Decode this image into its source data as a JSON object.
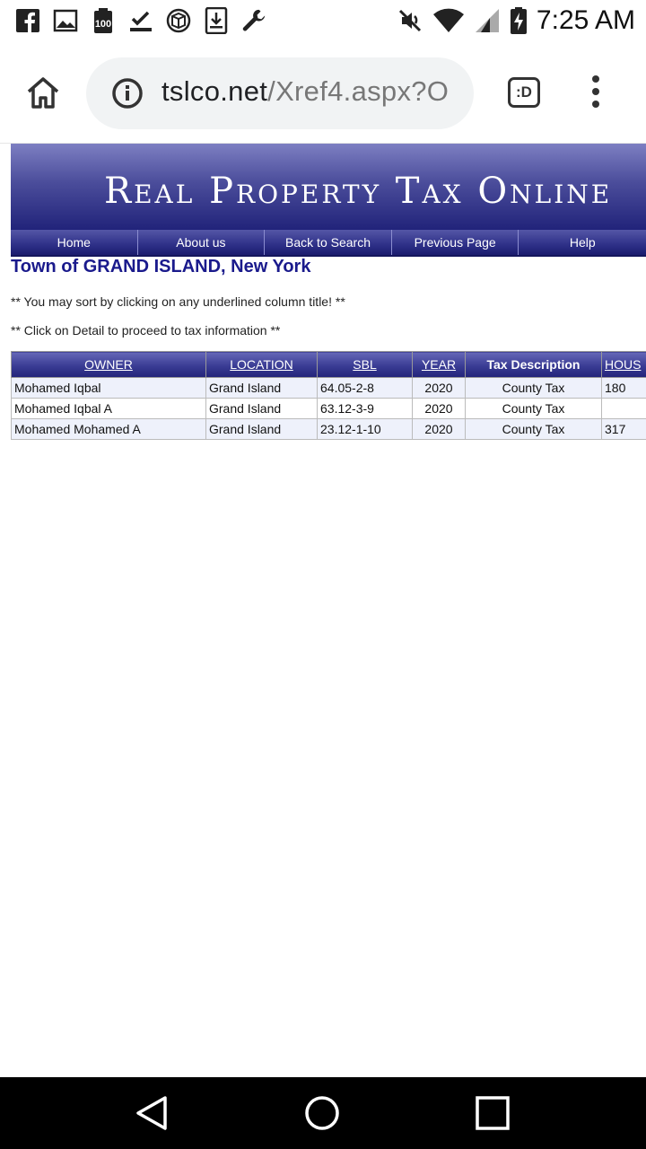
{
  "status_bar": {
    "time": "7:25 AM",
    "notification_icons": [
      "facebook-icon",
      "image-icon",
      "battery-100-icon",
      "check-download-icon",
      "3d-box-icon",
      "download-icon",
      "wrench-icon"
    ],
    "system_icons": [
      "mute-icon",
      "wifi-icon",
      "signal-icon",
      "battery-charging-icon"
    ]
  },
  "browser": {
    "url_host": "tslco.net",
    "url_path": "/Xref4.aspx?O",
    "tab_label": ":D"
  },
  "page": {
    "banner_title": "Real Property Tax Online",
    "nav": [
      "Home",
      "About us",
      "Back to Search",
      "Previous Page",
      "Help"
    ],
    "town_heading": "Town of GRAND ISLAND, New York",
    "note_sort": "** You may sort by clicking on any underlined column title! **",
    "note_detail": "** Click on Detail to proceed to tax information **",
    "table": {
      "headers": [
        "OWNER",
        "LOCATION",
        "SBL",
        "YEAR",
        "Tax Description",
        "HOUS"
      ],
      "rows": [
        [
          "Mohamed Iqbal",
          "Grand Island",
          "64.05-2-8",
          "2020",
          "County Tax",
          "180"
        ],
        [
          "Mohamed Iqbal A",
          "Grand Island",
          "63.12-3-9",
          "2020",
          "County Tax",
          ""
        ],
        [
          "Mohamed Mohamed A",
          "Grand Island",
          "23.12-1-10",
          "2020",
          "County Tax",
          "317"
        ]
      ]
    }
  },
  "colors": {
    "banner_top": "#7d7fc2",
    "banner_bottom": "#21237a",
    "heading": "#1a1a8c",
    "row_tint": "#eef1fb"
  }
}
